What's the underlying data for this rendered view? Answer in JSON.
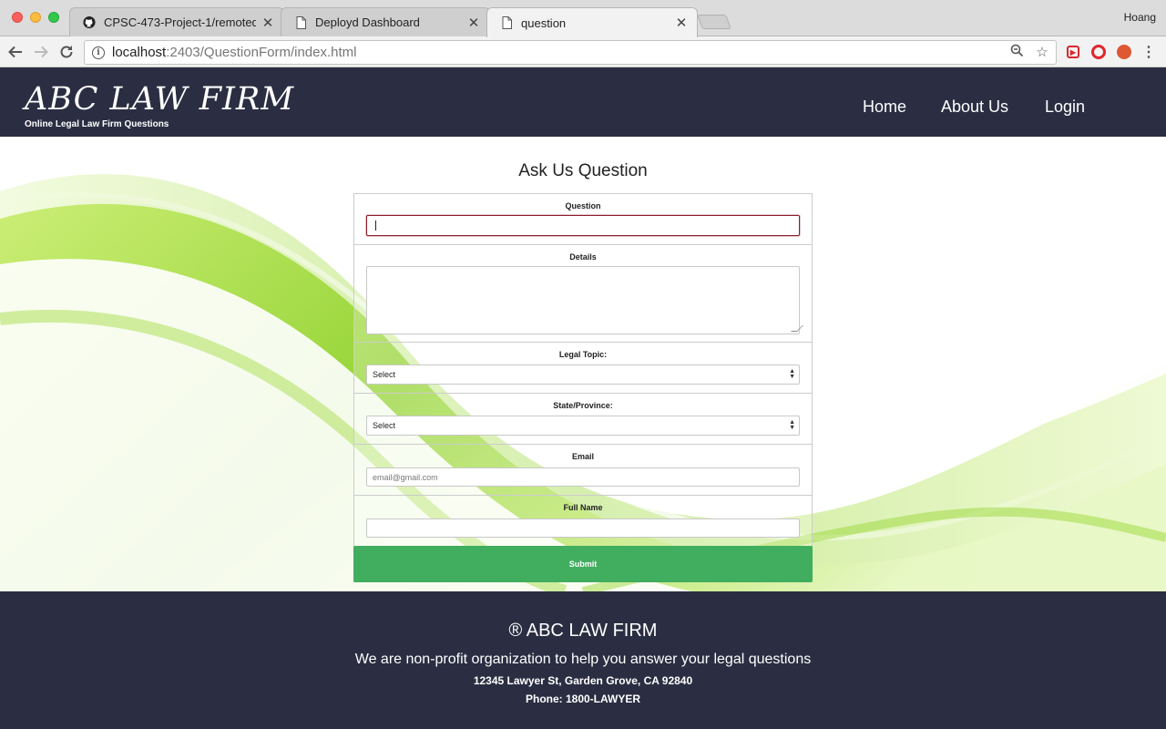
{
  "browser": {
    "tabs": [
      {
        "title": "CPSC-473-Project-1/remoted",
        "icon": "github-icon"
      },
      {
        "title": "Deployd Dashboard",
        "icon": "page-icon"
      },
      {
        "title": "question",
        "icon": "page-icon"
      }
    ],
    "profile": "Hoang",
    "url_host": "localhost",
    "url_rest": ":2403/QuestionForm/index.html",
    "close_glyph": "✕"
  },
  "header": {
    "brand": "ABC LAW FIRM",
    "tagline": "Online Legal Law Firm Questions",
    "nav": [
      "Home",
      "About Us",
      "Login"
    ]
  },
  "form": {
    "heading": "Ask Us Question",
    "question_label": "Question",
    "question_value": "",
    "details_label": "Details",
    "topic_label": "Legal Topic:",
    "topic_value": "Select",
    "state_label": "State/Province:",
    "state_value": "Select",
    "email_label": "Email",
    "email_placeholder": "email@gmail.com",
    "name_label": "Full Name",
    "submit_label": "Submit"
  },
  "footer": {
    "brand": "® ABC LAW FIRM",
    "mission": "We are non-profit organization to help you answer your legal questions",
    "address": "12345 Lawyer St, Garden Grove, CA 92840",
    "phone": "Phone: 1800-LAWYER"
  },
  "colors": {
    "header_bg": "#2b2e42",
    "submit_bg": "#41ad5f",
    "wave_green": "#8fd12a"
  }
}
